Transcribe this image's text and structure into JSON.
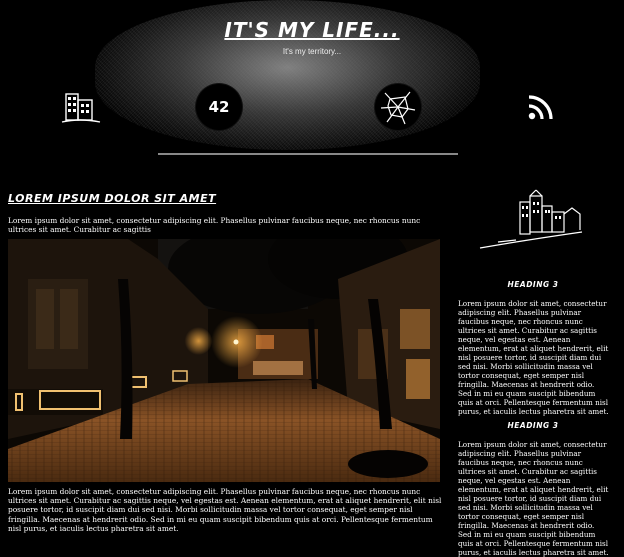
{
  "header": {
    "title": "It's my life...",
    "tagline": "It's my territory...",
    "nav_icons": [
      "buildings-icon",
      "42-icon",
      "shattered-glass-icon",
      "rss-icon"
    ],
    "badge_text": "42"
  },
  "main": {
    "heading": "Lorem ipsum dolor sit amet",
    "intro": "Lorem ipsum dolor sit amet, consectetur adipiscing elit. Phasellus pulvinar faucibus neque, nec rhoncus nunc ultrices sit amet. Curabitur ac sagittis",
    "photo_subject": "night-street-photo",
    "body": "Lorem ipsum dolor sit amet, consectetur adipiscing elit. Phasellus pulvinar faucibus neque, nec rhoncus nunc ultrices sit amet. Curabitur ac sagittis neque, vel egestas est. Aenean elementum, erat at aliquet hendrerit, elit nisl posuere tortor, id suscipit diam dui sed nisi. Morbi sollicitudin massa vel tortor consequat, eget semper nisl fringilla. Maecenas at hendrerit odio. Sed in mi eu quam suscipit bibendum quis at orci. Pellentesque fermentum nisl purus, et iaculis lectus pharetra sit amet."
  },
  "sidebar": {
    "icon": "city-sketch-icon",
    "sections": [
      {
        "heading": "Heading 3",
        "text": "Lorem ipsum dolor sit amet, consectetur adipiscing elit. Phasellus pulvinar faucibus neque, nec rhoncus nunc ultrices sit amet. Curabitur ac sagittis neque, vel egestas est. Aenean elementum, erat at aliquet hendrerit, elit nisl posuere tortor, id suscipit diam dui sed nisi. Morbi sollicitudin massa vel tortor consequat, eget semper nisl fringilla. Maecenas at hendrerit odio. Sed in mi eu quam suscipit bibendum quis at orci. Pellentesque fermentum nisl purus, et iaculis lectus pharetra sit amet."
      },
      {
        "heading": "Heading 3",
        "text": "Lorem ipsum dolor sit amet, consectetur adipiscing elit. Phasellus pulvinar faucibus neque, nec rhoncus nunc ultrices sit amet. Curabitur ac sagittis neque, vel egestas est. Aenean elementum, erat at aliquet hendrerit, elit nisl posuere tortor, id suscipit diam dui sed nisi. Morbi sollicitudin massa vel tortor consequat, eget semper nisl fringilla. Maecenas at hendrerit odio. Sed in mi eu quam suscipit bibendum quis at orci. Pellentesque fermentum nisl purus, et iaculis lectus pharetra sit amet."
      }
    ]
  },
  "colors": {
    "background": "#000000",
    "text": "#ffffff",
    "rule": "#888888",
    "lamp_glow": "#ffb347"
  }
}
